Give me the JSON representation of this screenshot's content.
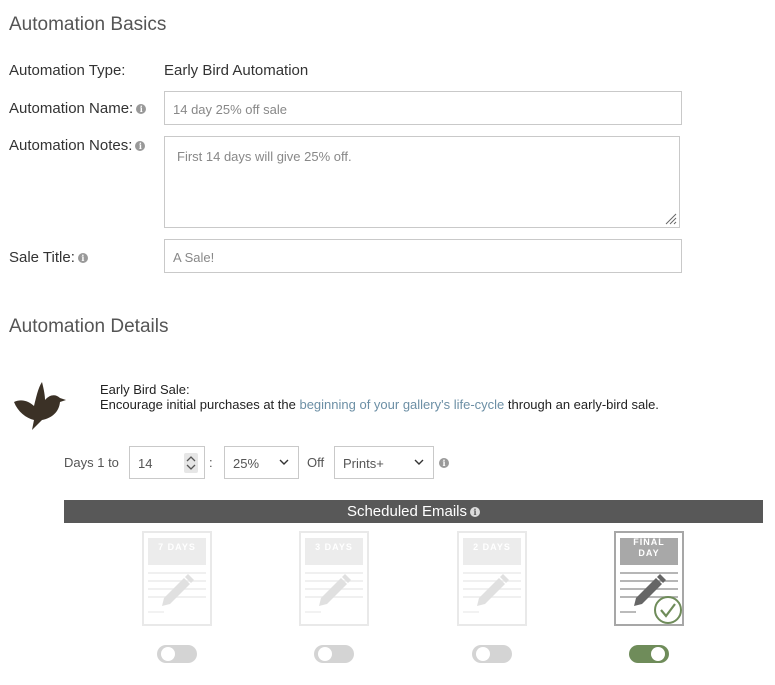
{
  "basics": {
    "title": "Automation Basics",
    "type_label": "Automation Type:",
    "type_value": "Early Bird Automation",
    "name_label": "Automation Name:",
    "name_value": "14 day 25% off sale",
    "notes_label": "Automation Notes:",
    "notes_value": "First 14 days will give 25% off.",
    "sale_title_label": "Sale Title:",
    "sale_title_value": "A Sale!"
  },
  "details": {
    "title": "Automation Details",
    "sale_heading": "Early Bird Sale:",
    "desc_before": "Encourage initial purchases at the ",
    "desc_link": "beginning of your gallery's life-cycle",
    "desc_after": " through an early-bird sale.",
    "days_label": "Days 1 to",
    "days_value": "14",
    "colon": ":",
    "percent_value": "25%",
    "off_label": "Off",
    "product_value": "Prints+"
  },
  "emails": {
    "bar_label": "Scheduled Emails",
    "cards": [
      {
        "label": "7 DAYS",
        "enabled": false
      },
      {
        "label": "3 DAYS",
        "enabled": false
      },
      {
        "label": "2 DAYS",
        "enabled": false
      },
      {
        "label": "FINAL\nDAY",
        "enabled": true
      }
    ]
  },
  "colors": {
    "accent_green": "#6f8c5a",
    "bar_gray": "#585858",
    "bird_brown": "#3b3126",
    "link_blue": "#6c8fa5"
  }
}
